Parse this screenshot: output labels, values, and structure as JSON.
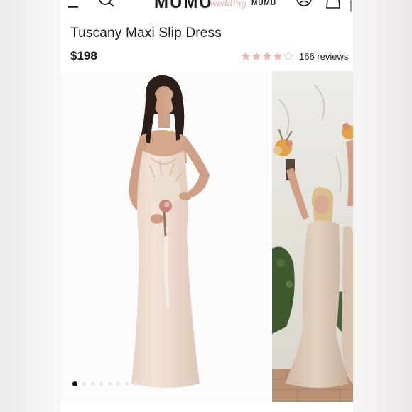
{
  "header": {
    "logo_main": "MUMU",
    "logo_script": "wedding",
    "logo_sub": "MUMU"
  },
  "product": {
    "title": "Tuscany Maxi Slip Dress",
    "price": "$198",
    "rating": 4,
    "rating_max": 5,
    "reviews_label": "166 reviews"
  },
  "gallery": {
    "image_count": 9,
    "active_index": 0
  },
  "colors": {
    "star_filled": "#f2b3b3",
    "star_empty": "#f0c6c6",
    "text": "#1b1b1b"
  },
  "icons": [
    "menu-icon",
    "search-icon",
    "account-icon",
    "bag-icon",
    "star-icon"
  ]
}
